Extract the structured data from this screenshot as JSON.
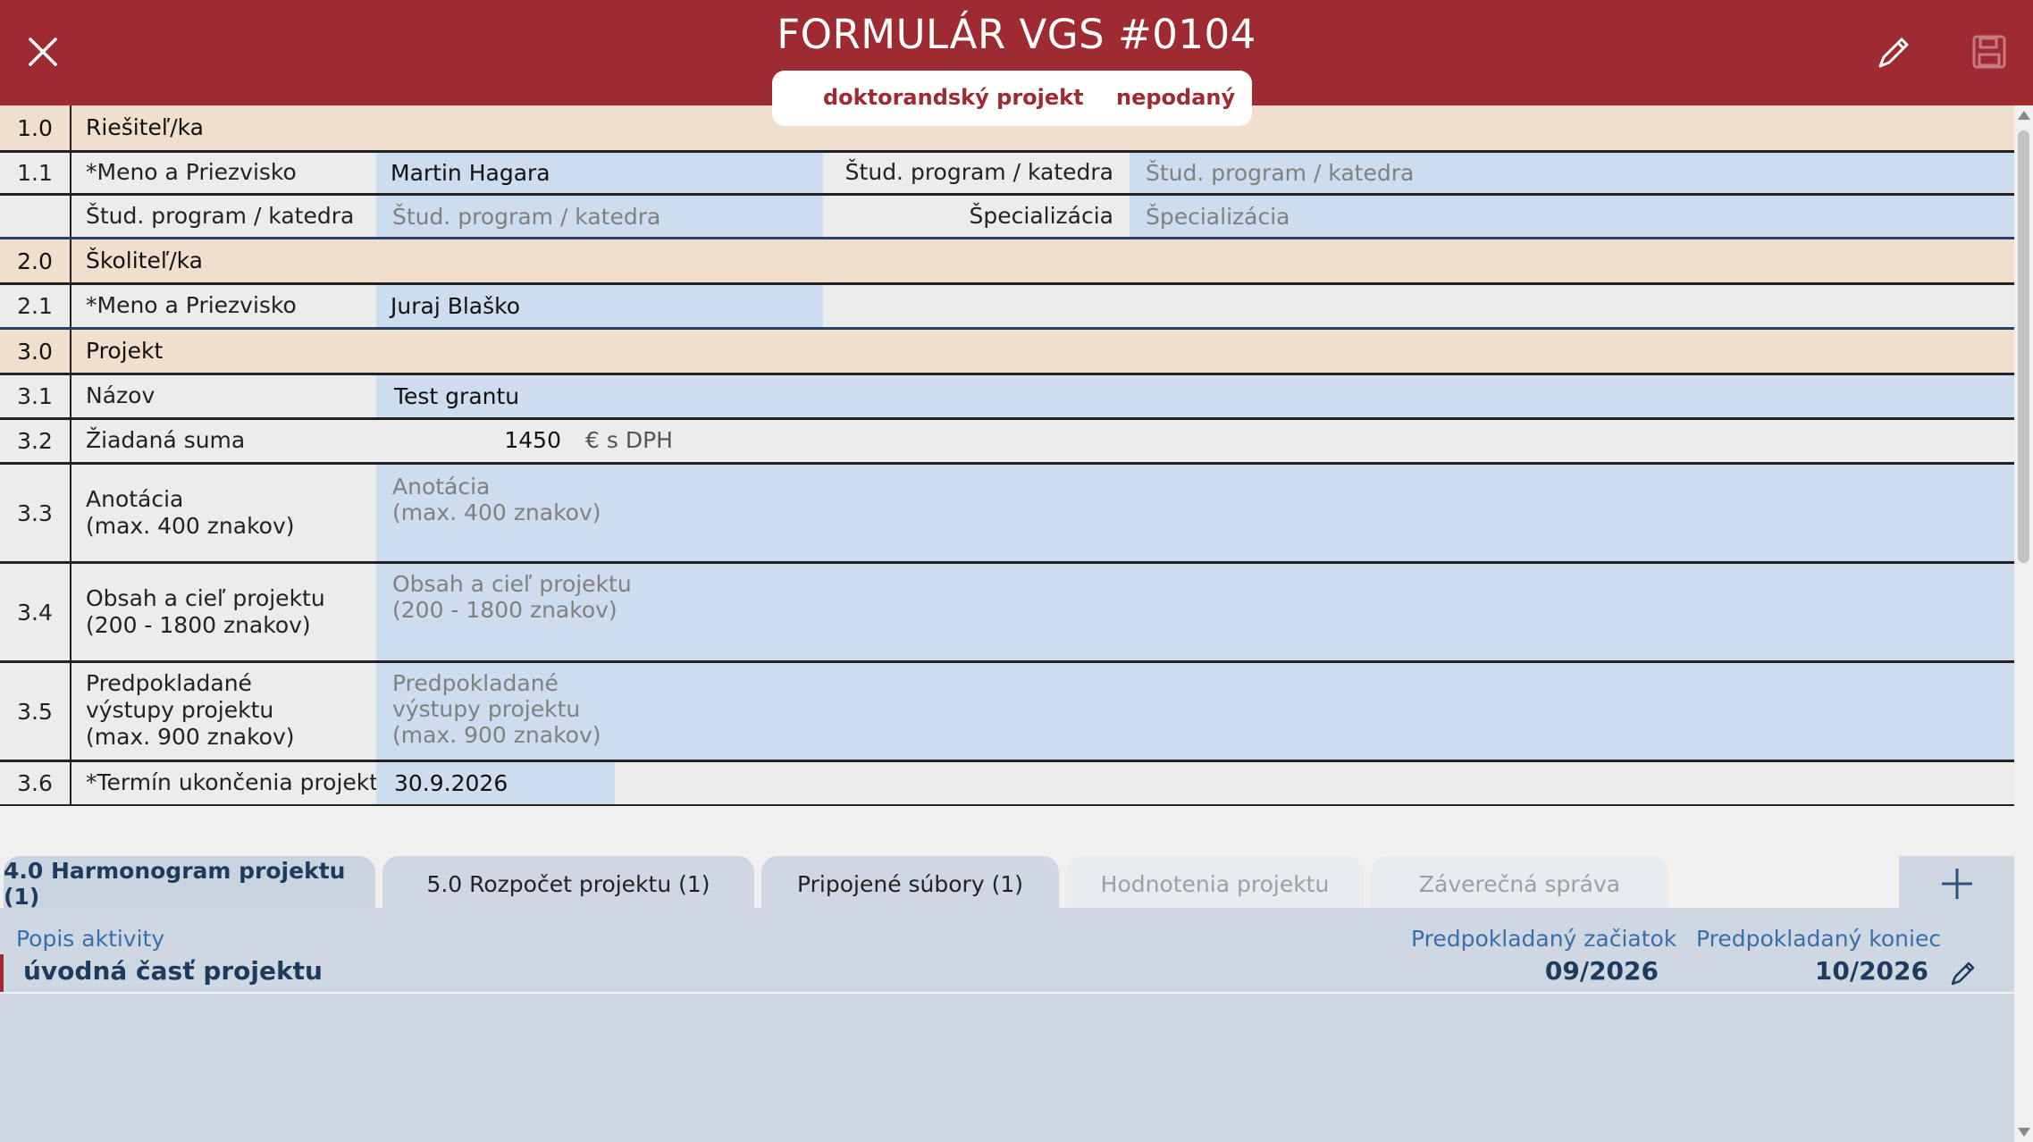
{
  "header": {
    "title": "FORMULÁR VGS #0104",
    "project_type": "doktorandský projekt",
    "status": "nepodaný"
  },
  "section1": {
    "num": "1.0",
    "label": "Riešiteľ/ka",
    "row1": {
      "num": "1.1",
      "label": "*Meno a Priezvisko",
      "value": "Martin Hagara",
      "right_label": "Štud. program / katedra",
      "right_placeholder": "Štud. program / katedra"
    },
    "row2": {
      "label": "Štud. program / katedra",
      "placeholder": "Štud. program / katedra",
      "right_label": "Špecializácia",
      "right_placeholder": "Špecializácia"
    }
  },
  "section2": {
    "num": "2.0",
    "label": "Školiteľ/ka",
    "row1": {
      "num": "2.1",
      "label": "*Meno a Priezvisko",
      "value": "Juraj Blaško"
    }
  },
  "section3": {
    "num": "3.0",
    "label": "Projekt",
    "title_row": {
      "num": "3.1",
      "label": "Názov",
      "value": "Test grantu"
    },
    "sum_row": {
      "num": "3.2",
      "label": "Žiadaná suma",
      "value": "1450",
      "unit": "€ s DPH"
    },
    "annot_row": {
      "num": "3.3",
      "label": "Anotácia\n(max. 400 znakov)",
      "placeholder": "Anotácia\n(max. 400 znakov)"
    },
    "content_row": {
      "num": "3.4",
      "label": "Obsah a cieľ projektu\n(200 - 1800 znakov)",
      "placeholder": "Obsah a cieľ projektu\n(200 - 1800 znakov)"
    },
    "outputs_row": {
      "num": "3.5",
      "label": "Predpokladané\nvýstupy projektu\n(max. 900 znakov)",
      "placeholder": "Predpokladané\nvýstupy projektu\n(max. 900 znakov)"
    },
    "deadline_row": {
      "num": "3.6",
      "label": "*Termín ukončenia projektu",
      "value": "30.9.2026"
    }
  },
  "tabs": [
    {
      "label": "4.0 Harmonogram projektu (1)"
    },
    {
      "label": "5.0 Rozpočet projektu (1)"
    },
    {
      "label": "Pripojené súbory (1)"
    },
    {
      "label": "Hodnotenia projektu"
    },
    {
      "label": "Záverečná správa"
    }
  ],
  "harmonogram": {
    "col_activity": "Popis aktivity",
    "col_start": "Predpokladaný začiatok",
    "col_end": "Predpokladaný koniec",
    "items": [
      {
        "name": "úvodná časť projektu",
        "start": "09/2026",
        "end": "10/2026"
      }
    ]
  },
  "colors": {
    "brand": "#9e2a32",
    "field_bg": "#cddcee",
    "section_bg": "#efdfcc",
    "accent_blue": "#3a6ea8"
  }
}
